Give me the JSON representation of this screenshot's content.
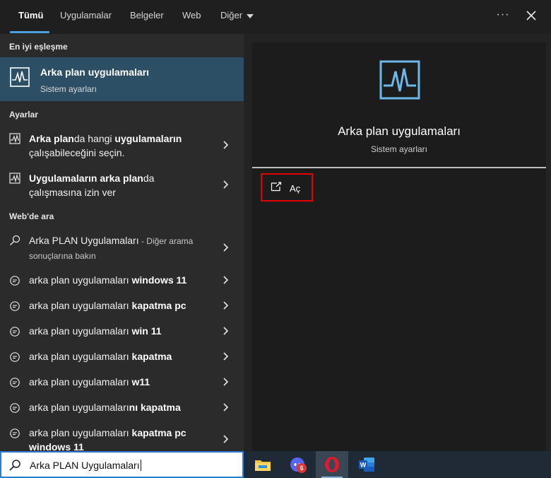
{
  "tabs": [
    {
      "label": "Tümü",
      "active": true
    },
    {
      "label": "Uygulamalar"
    },
    {
      "label": "Belgeler"
    },
    {
      "label": "Web"
    },
    {
      "label": "Diğer"
    }
  ],
  "best_match": {
    "section_title": "En iyi eşleşme",
    "title": "Arka plan uygulamaları",
    "subtitle": "Sistem ayarları"
  },
  "settings": {
    "section_title": "Ayarlar",
    "items": [
      {
        "b1": "Arka plan",
        "t1": "da hangi ",
        "b2": "uygulamaların",
        "t2": "çalışabileceğini seçin."
      },
      {
        "b1": "Uygulamaların arka plan",
        "t1": "da",
        "t2": "çalışmasına izin ver"
      }
    ]
  },
  "web": {
    "section_title": "Web'de ara",
    "first": {
      "text": "Arka PLAN Uygulamaları",
      "suffix": " - Diğer arama",
      "line2": "sonuçlarına bakın"
    },
    "items": [
      {
        "plain": "arka plan uygulamaları ",
        "bold": "windows 11"
      },
      {
        "plain": "arka plan uygulamaları ",
        "bold": "kapatma pc"
      },
      {
        "plain": "arka plan uygulamaları ",
        "bold": "win 11"
      },
      {
        "plain": "arka plan uygulamaları ",
        "bold": "kapatma"
      },
      {
        "plain": "arka plan uygulamaları ",
        "bold": "w11"
      },
      {
        "plain": "arka plan uygulamaları",
        "bold": "nı kapatma"
      },
      {
        "plain": "arka plan uygulamaları ",
        "bold": "kapatma pc",
        "line2": "windows 11"
      }
    ]
  },
  "preview": {
    "title": "Arka plan uygulamaları",
    "subtitle": "Sistem ayarları",
    "open_label": "Aç"
  },
  "search": {
    "value": "Arka PLAN Uygulamaları"
  },
  "taskbar": {
    "apps": [
      "file-explorer",
      "discord",
      "opera",
      "word"
    ],
    "discord_badge": "6"
  },
  "colors": {
    "accent": "#4aa3df",
    "highlight": "#2d4f66",
    "outline": "#e00000"
  }
}
